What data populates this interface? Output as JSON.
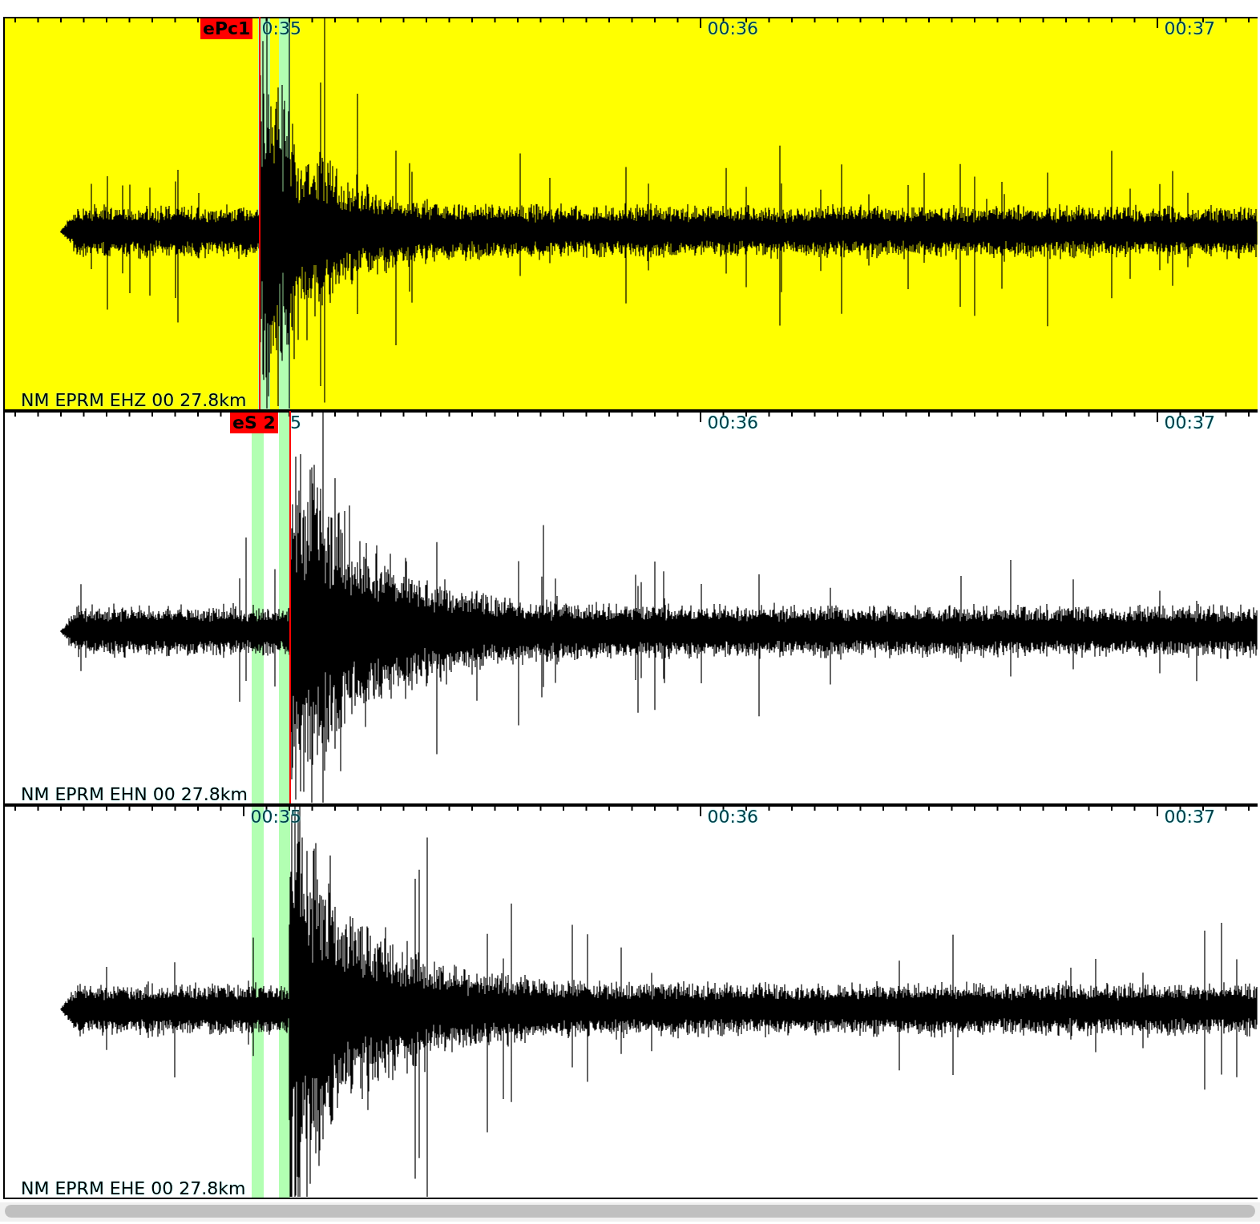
{
  "traces": [
    {
      "label": "NM EPRM EHZ 00 27.8km",
      "selected": true,
      "ticks": [
        "0:35",
        "00:36",
        "00:37"
      ],
      "pick": {
        "label": "ePc1"
      }
    },
    {
      "label": "NM EPRM EHN 00 27.8km",
      "selected": false,
      "ticks": [
        "5",
        "00:36",
        "00:37"
      ],
      "pick": {
        "label": "eS 2"
      }
    },
    {
      "label": "NM EPRM EHE 00 27.8km",
      "selected": false,
      "ticks": [
        "00:35",
        "00:36",
        "00:37"
      ]
    }
  ]
}
